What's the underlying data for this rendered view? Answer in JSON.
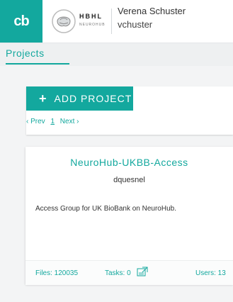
{
  "header": {
    "logo_text": "cb",
    "brand_title": "HBHL",
    "brand_subtitle": "NEUROHUB",
    "user_name": "Verena Schuster",
    "user_login": "vchuster"
  },
  "tabs": [
    {
      "label": "Projects",
      "active": true
    }
  ],
  "toolbar": {
    "add_icon": "+",
    "add_label": "ADD PROJECT"
  },
  "pager": {
    "prev": "‹ Prev",
    "current": "1",
    "next": "Next ›"
  },
  "project_card": {
    "title": "NeuroHub-UKBB-Access",
    "owner": "dquesnel",
    "description": "Access Group for UK BioBank on NeuroHub.",
    "files": "Files: 120035",
    "tasks": "Tasks: 0",
    "users": "Users: 13"
  },
  "colors": {
    "accent": "#13a89e",
    "background": "#f3f4f5"
  }
}
